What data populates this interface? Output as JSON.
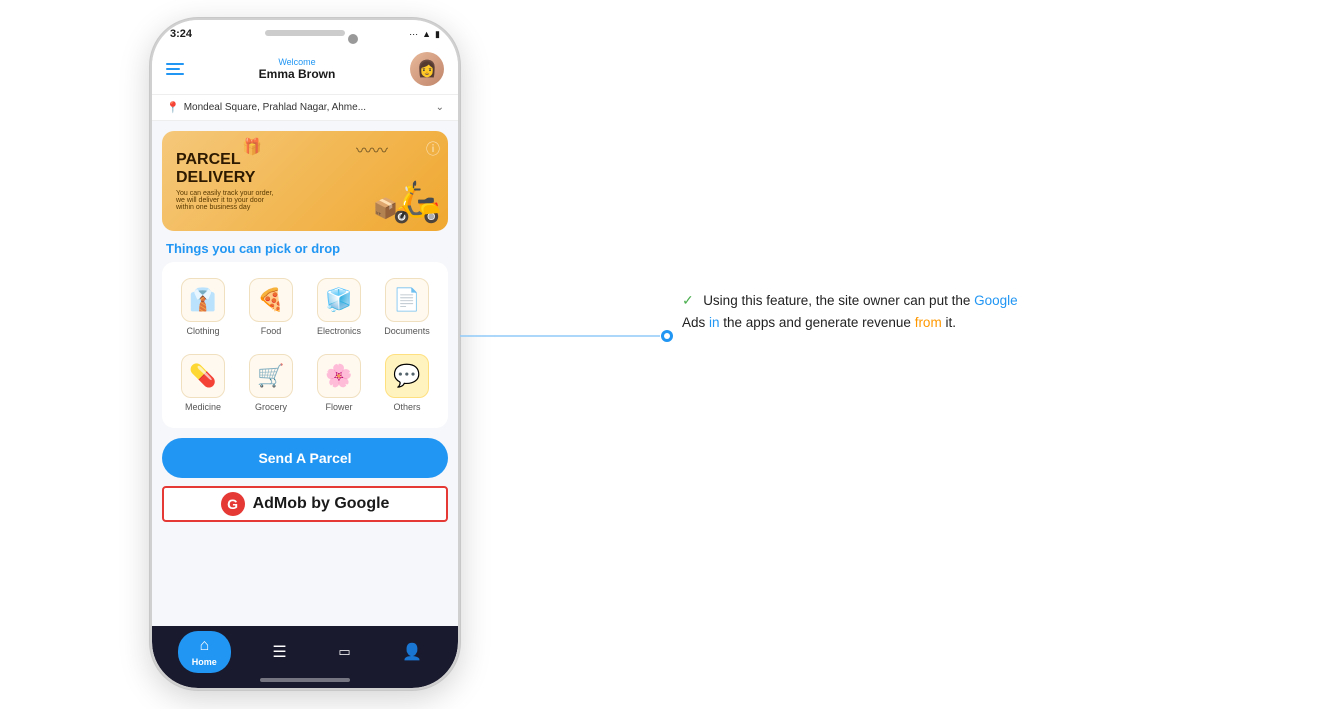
{
  "phone": {
    "status_time": "3:24",
    "status_arrow": "▲",
    "status_wifi": "wifi",
    "status_battery": "battery"
  },
  "header": {
    "welcome_label": "Welcome",
    "user_name": "Emma Brown",
    "avatar_emoji": "👩"
  },
  "location": {
    "text": "Mondeal Square, Prahlad Nagar, Ahme...",
    "chevron": "⌄"
  },
  "banner": {
    "title_line1": "PARCEL",
    "title_line2": "DELIVERY",
    "subtitle": "You can easily track your order, we will deliver it to your door within one business day",
    "scooter_emoji": "🛵",
    "box_emoji": "📦"
  },
  "section": {
    "title": "Things you can pick or drop"
  },
  "categories": [
    {
      "id": "clothing",
      "icon": "👔",
      "label": "Clothing"
    },
    {
      "id": "food",
      "icon": "🍕",
      "label": "Food"
    },
    {
      "id": "electronics",
      "icon": "🧊",
      "label": "Electronics"
    },
    {
      "id": "documents",
      "icon": "📄",
      "label": "Documents"
    },
    {
      "id": "medicine",
      "icon": "💊",
      "label": "Medicine"
    },
    {
      "id": "grocery",
      "icon": "🛒",
      "label": "Grocery"
    },
    {
      "id": "flower",
      "icon": "🌸",
      "label": "Flower"
    },
    {
      "id": "others",
      "icon": "💬",
      "label": "Others"
    }
  ],
  "send_parcel_btn": "Send A Parcel",
  "admob": {
    "logo_letter": "G",
    "text": "AdMob by Google"
  },
  "bottom_nav": [
    {
      "id": "home",
      "icon": "⌂",
      "label": "Home",
      "active": true
    },
    {
      "id": "orders",
      "icon": "☰",
      "label": "",
      "active": false
    },
    {
      "id": "wallet",
      "icon": "▭",
      "label": "",
      "active": false
    },
    {
      "id": "profile",
      "icon": "👤",
      "label": "",
      "active": false
    }
  ],
  "annotation": {
    "check_icon": "✅",
    "text_parts": [
      {
        "text": "Using this feature, the site owner can put the Google",
        "highlight": "none"
      },
      {
        "text": "Ads ",
        "highlight": "none"
      },
      {
        "text": "in",
        "highlight": "none"
      },
      {
        "text": " the apps and generate revenue ",
        "highlight": "none"
      },
      {
        "text": "from",
        "highlight": "none"
      },
      {
        "text": " it.",
        "highlight": "none"
      }
    ],
    "line1": "Using this feature, the site owner can put the Google",
    "line2": "Ads in the apps and generate revenue from it."
  }
}
